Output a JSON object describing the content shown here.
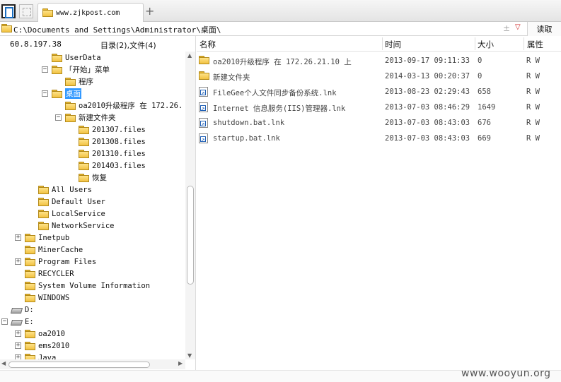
{
  "tab": {
    "title": "www.zjkpost.com",
    "new_tab": "+"
  },
  "address": {
    "path": "C:\\Documents and Settings\\Administrator\\桌面\\",
    "pm": "±",
    "dropdown": "▽",
    "read_button": "读取"
  },
  "left": {
    "host": "60.8.197.38",
    "counts": "目录(2),文件(4)",
    "tree": [
      {
        "label": "UserData",
        "icon": "folder-icon",
        "indent": 3,
        "expander": "none"
      },
      {
        "label": "「开始」菜单",
        "icon": "folder-icon",
        "indent": 3,
        "expander": "−"
      },
      {
        "label": "程序",
        "icon": "folder-icon",
        "indent": 4,
        "expander": "none"
      },
      {
        "label": "桌面",
        "icon": "folder-icon",
        "indent": 3,
        "expander": "−",
        "selected": true
      },
      {
        "label": "oa2010升级程序 在 172.26.",
        "icon": "folder-icon",
        "indent": 4,
        "expander": "none"
      },
      {
        "label": "新建文件夹",
        "icon": "folder-icon",
        "indent": 4,
        "expander": "−"
      },
      {
        "label": "201307.files",
        "icon": "folder-icon",
        "indent": 5,
        "expander": "none"
      },
      {
        "label": "201308.files",
        "icon": "folder-icon",
        "indent": 5,
        "expander": "none"
      },
      {
        "label": "201310.files",
        "icon": "folder-icon",
        "indent": 5,
        "expander": "none"
      },
      {
        "label": "201403.files",
        "icon": "folder-icon",
        "indent": 5,
        "expander": "none"
      },
      {
        "label": "恢复",
        "icon": "folder-icon",
        "indent": 5,
        "expander": "none"
      },
      {
        "label": "All Users",
        "icon": "folder-icon",
        "indent": 2,
        "expander": "none"
      },
      {
        "label": "Default User",
        "icon": "folder-icon",
        "indent": 2,
        "expander": "none"
      },
      {
        "label": "LocalService",
        "icon": "folder-icon",
        "indent": 2,
        "expander": "none"
      },
      {
        "label": "NetworkService",
        "icon": "folder-icon",
        "indent": 2,
        "expander": "none"
      },
      {
        "label": "Inetpub",
        "icon": "folder-icon",
        "indent": 1,
        "expander": "+"
      },
      {
        "label": "MinerCache",
        "icon": "folder-icon",
        "indent": 1,
        "expander": "none"
      },
      {
        "label": "Program Files",
        "icon": "folder-icon",
        "indent": 1,
        "expander": "+"
      },
      {
        "label": "RECYCLER",
        "icon": "folder-icon",
        "indent": 1,
        "expander": "none"
      },
      {
        "label": "System Volume Information",
        "icon": "folder-icon",
        "indent": 1,
        "expander": "none"
      },
      {
        "label": "WINDOWS",
        "icon": "folder-icon",
        "indent": 1,
        "expander": "none"
      },
      {
        "label": "D:",
        "icon": "drive-icon",
        "indent": 0,
        "expander": "none"
      },
      {
        "label": "E:",
        "icon": "drive-icon",
        "indent": 0,
        "expander": "−"
      },
      {
        "label": "oa2010",
        "icon": "folder-icon",
        "indent": 1,
        "expander": "+"
      },
      {
        "label": "ems2010",
        "icon": "folder-icon",
        "indent": 1,
        "expander": "+"
      },
      {
        "label": "Java",
        "icon": "folder-icon",
        "indent": 1,
        "expander": "+"
      }
    ]
  },
  "columns": {
    "name": "名称",
    "time": "时间",
    "size": "大小",
    "attr": "属性"
  },
  "files": [
    {
      "name": "oa2010升级程序 在 172.26.21.10 上",
      "time": "2013-09-17 09:11:33",
      "size": "0",
      "attr": "R W",
      "icon": "folder-icon"
    },
    {
      "name": "新建文件夹",
      "time": "2014-03-13 00:20:37",
      "size": "0",
      "attr": "R W",
      "icon": "folder-icon"
    },
    {
      "name": "FileGee个人文件同步备份系统.lnk",
      "time": "2013-08-23 02:29:43",
      "size": "658",
      "attr": "R W",
      "icon": "shortcut-icon"
    },
    {
      "name": "Internet 信息服务(IIS)管理器.lnk",
      "time": "2013-07-03 08:46:29",
      "size": "1649",
      "attr": "R W",
      "icon": "shortcut-icon"
    },
    {
      "name": "shutdown.bat.lnk",
      "time": "2013-07-03 08:43:03",
      "size": "676",
      "attr": "R W",
      "icon": "shortcut-icon"
    },
    {
      "name": "startup.bat.lnk",
      "time": "2013-07-03 08:43:03",
      "size": "669",
      "attr": "R W",
      "icon": "shortcut-icon"
    }
  ],
  "watermark": "www.wooyun.org"
}
